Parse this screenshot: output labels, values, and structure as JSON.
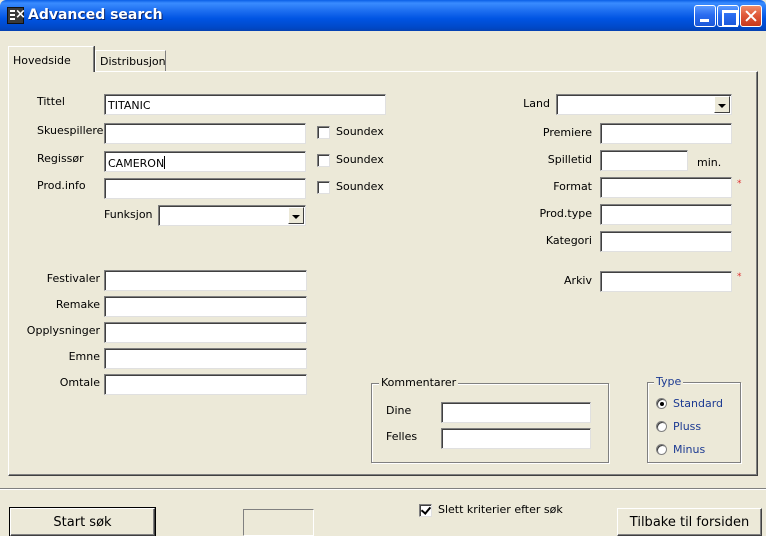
{
  "window": {
    "title": "Advanced search"
  },
  "tabs": [
    {
      "label": "Hovedside",
      "active": true
    },
    {
      "label": "Distribusjon",
      "active": false
    }
  ],
  "left_fields": {
    "tittel": {
      "label": "Tittel",
      "value": "TITANIC"
    },
    "skuespillere": {
      "label": "Skuespillere",
      "value": "",
      "soundex_label": "Soundex",
      "soundex_checked": false
    },
    "regissor": {
      "label": "Regissør",
      "value": "CAMERON",
      "soundex_label": "Soundex",
      "soundex_checked": false
    },
    "prodinfo": {
      "label": "Prod.info",
      "value": "",
      "soundex_label": "Soundex",
      "soundex_checked": false
    },
    "funksjon": {
      "label": "Funksjon",
      "value": ""
    }
  },
  "right_fields": {
    "land": {
      "label": "Land",
      "value": ""
    },
    "premiere": {
      "label": "Premiere",
      "value": ""
    },
    "spilletid": {
      "label": "Spilletid",
      "value": "",
      "unit": "min."
    },
    "format": {
      "label": "Format",
      "value": ""
    },
    "prodtype": {
      "label": "Prod.type",
      "value": ""
    },
    "kategori": {
      "label": "Kategori",
      "value": ""
    },
    "arkiv": {
      "label": "Arkiv",
      "value": ""
    }
  },
  "required_marker": "*",
  "lower_fields": [
    {
      "label": "Festivaler",
      "value": ""
    },
    {
      "label": "Remake",
      "value": ""
    },
    {
      "label": "Opplysninger",
      "value": ""
    },
    {
      "label": "Emne",
      "value": ""
    },
    {
      "label": "Omtale",
      "value": ""
    }
  ],
  "kommentarer": {
    "title": "Kommentarer",
    "dine": {
      "label": "Dine",
      "value": ""
    },
    "felles": {
      "label": "Felles",
      "value": ""
    }
  },
  "type_group": {
    "title": "Type",
    "options": [
      {
        "label": "Standard",
        "selected": true
      },
      {
        "label": "Pluss",
        "selected": false
      },
      {
        "label": "Minus",
        "selected": false
      }
    ]
  },
  "bottom": {
    "start_label": "Start søk",
    "status_text": "",
    "clear_label": "Slett kriterier efter søk",
    "clear_checked": true,
    "back_label": "Tilbake til forsiden"
  },
  "colors": {
    "titlebar": "#0054E3",
    "face": "#ECE9D8",
    "required": "#E03030",
    "type_text": "#1C3A92"
  }
}
